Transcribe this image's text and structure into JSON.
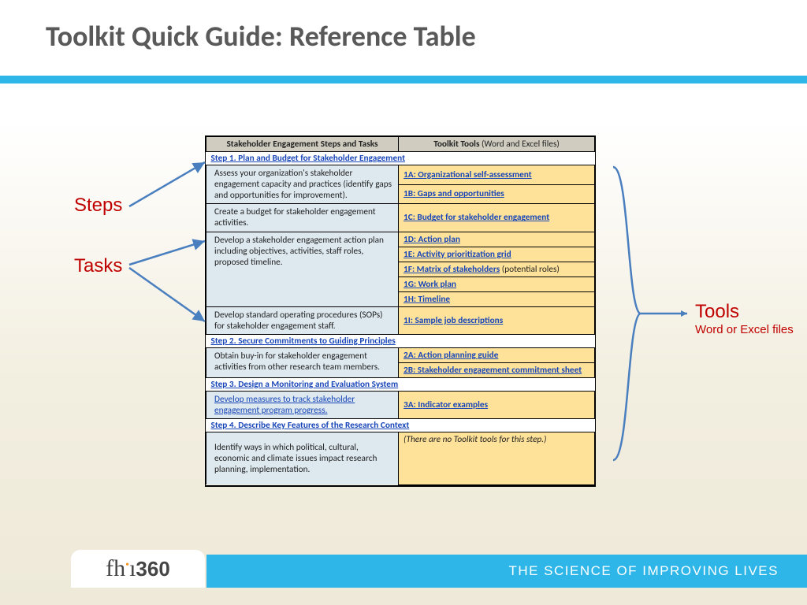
{
  "title": "Toolkit Quick Guide:  Reference Table",
  "headers": {
    "left": "Stakeholder Engagement Steps and Tasks",
    "right_main": "Toolkit Tools",
    "right_sub": " (Word and Excel files)"
  },
  "steps": [
    {
      "name": "Step 1. Plan and Budget for Stakeholder Engagement",
      "rows": [
        {
          "task": "Assess your organization's stakeholder engagement capacity and practices (identify gaps and opportunities for improvement).",
          "tools": [
            {
              "label": "1A: Organizational self-assessment"
            },
            {
              "label": "1B: Gaps and opportunities"
            }
          ]
        },
        {
          "task": "Create a budget for stakeholder engagement activities.",
          "tools": [
            {
              "label": "1C: Budget for stakeholder engagement"
            }
          ]
        },
        {
          "task": "Develop a stakeholder engagement action plan including objectives, activities, staff roles, proposed timeline.",
          "tools": [
            {
              "label": "1D: Action plan"
            },
            {
              "label": "1E: Activity prioritization grid"
            },
            {
              "label": "1F: Matrix of stakeholders",
              "note": " (potential roles)"
            },
            {
              "label": "1G: Work plan"
            },
            {
              "label": "1H: Timeline"
            }
          ]
        },
        {
          "task": "Develop standard operating procedures (SOPs) for stakeholder engagement staff.",
          "tools": [
            {
              "label": "1I: Sample job descriptions"
            }
          ]
        }
      ]
    },
    {
      "name": "Step 2. Secure Commitments to Guiding Principles",
      "rows": [
        {
          "task": "Obtain buy-in for stakeholder engagement activities from other research team members.",
          "tools": [
            {
              "label": "2A: Action planning guide"
            },
            {
              "label": "2B: Stakeholder engagement commitment sheet"
            }
          ]
        }
      ]
    },
    {
      "name": "Step 3. Design a Monitoring and Evaluation System",
      "rows": [
        {
          "task_link": "Develop measures to track stakeholder engagement program progress.",
          "tools": [
            {
              "label": "3A: Indicator examples"
            }
          ]
        }
      ]
    },
    {
      "name": "Step 4. Describe Key Features of the Research Context",
      "rows": [
        {
          "task": "Identify ways in which political, cultural, economic and climate issues impact research planning, implementation.",
          "tools_text": "(There are no Toolkit tools for this step.)"
        }
      ]
    }
  ],
  "annotations": {
    "steps": "Steps",
    "tasks": "Tasks",
    "tools_title": "Tools",
    "tools_sub": "Word or Excel files"
  },
  "footer": {
    "tagline": "THE SCIENCE OF IMPROVING LIVES",
    "logo_a": "fh",
    "logo_b": "360"
  }
}
